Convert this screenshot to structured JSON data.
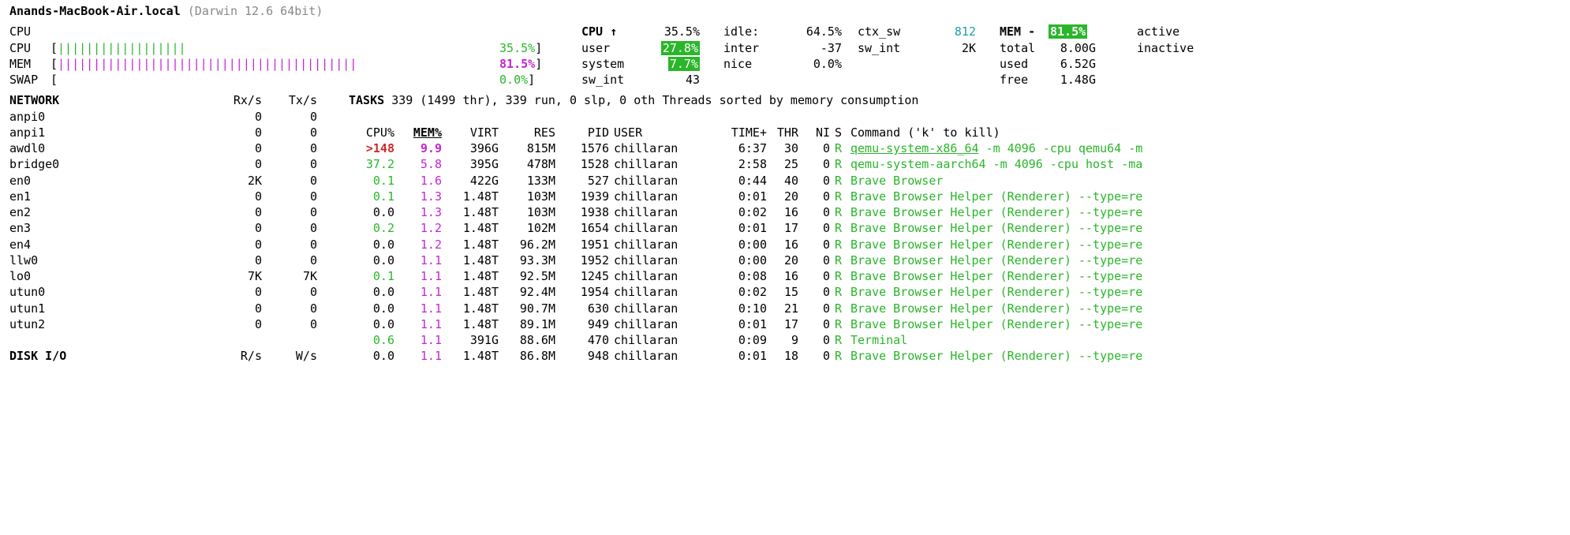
{
  "host": {
    "name": "Anands-MacBook-Air.local",
    "os": "(Darwin 12.6 64bit)"
  },
  "meters": {
    "cpu_label": "CPU",
    "cpu_bar": "||||||||||||||||||",
    "cpu_pct": "35.5%",
    "mem_label": "MEM",
    "mem_bar": "||||||||||||||||||||||||||||||||||||||||||",
    "mem_pct": "81.5%",
    "swap_label": "SWAP",
    "swap_bar": "",
    "swap_pct": "0.0%"
  },
  "cpu_stats": {
    "title": "CPU ↑",
    "title_val": "35.5%",
    "user_l": "user",
    "user_v": "27.8%",
    "system_l": "system",
    "system_v": "7.7%",
    "swint_topl": "sw_int",
    "swint_topv": "43",
    "idle_l": "idle:",
    "idle_v": "64.5%",
    "inter_l": "inter",
    "inter_v": "-37",
    "nice_l": "nice",
    "nice_v": "0.0%",
    "ctx_l": "ctx_sw",
    "ctx_v": "812",
    "swint_l": "sw_int",
    "swint_v": "2K"
  },
  "mem_stats": {
    "title": "MEM -",
    "title_v": "81.5%",
    "total_l": "total",
    "total_v": "8.00G",
    "used_l": "used",
    "used_v": "6.52G",
    "free_l": "free",
    "free_v": "1.48G",
    "active_l": "active",
    "inactive_l": "inactive"
  },
  "tasks_line": {
    "l": "TASKS",
    "r": "339 (1499 thr), 339 run, 0 slp, 0 oth Threads sorted by memory consumption"
  },
  "net_hdr": {
    "l": "NETWORK",
    "rx": "Rx/s",
    "tx": "Tx/s"
  },
  "disk_hdr": {
    "l": "DISK I/O",
    "r": "R/s",
    "w": "W/s"
  },
  "net_ifs": [
    {
      "n": "anpi0",
      "rx": "0",
      "tx": "0"
    },
    {
      "n": "anpi1",
      "rx": "0",
      "tx": "0"
    },
    {
      "n": "awdl0",
      "rx": "0",
      "tx": "0"
    },
    {
      "n": "bridge0",
      "rx": "0",
      "tx": "0"
    },
    {
      "n": "en0",
      "rx": "2K",
      "tx": "0"
    },
    {
      "n": "en1",
      "rx": "0",
      "tx": "0"
    },
    {
      "n": "en2",
      "rx": "0",
      "tx": "0"
    },
    {
      "n": "en3",
      "rx": "0",
      "tx": "0"
    },
    {
      "n": "en4",
      "rx": "0",
      "tx": "0"
    },
    {
      "n": "llw0",
      "rx": "0",
      "tx": "0"
    },
    {
      "n": "lo0",
      "rx": "7K",
      "tx": "7K"
    },
    {
      "n": "utun0",
      "rx": "0",
      "tx": "0"
    },
    {
      "n": "utun1",
      "rx": "0",
      "tx": "0"
    },
    {
      "n": "utun2",
      "rx": "0",
      "tx": "0"
    }
  ],
  "proc_hdr": {
    "cpu": "CPU%",
    "mem": "MEM%",
    "virt": "VIRT",
    "res": "RES",
    "pid": "PID",
    "user": "USER",
    "time": "TIME+",
    "thr": "THR",
    "ni": "NI",
    "s": "S",
    "cmd": "Command ('k' to kill)"
  },
  "procs": [
    {
      "cpu": ">148",
      "cpu_class": "red bold",
      "mem": "9.9",
      "mem_b": true,
      "virt": "396G",
      "res": "815M",
      "pid": "1576",
      "user": "chillaran",
      "time": "6:37",
      "thr": "30",
      "ni": "0",
      "s": "R",
      "cmd1": "qemu-system-x86_64",
      "cmd2": " -m 4096 -cpu qemu64 -m"
    },
    {
      "cpu": "37.2",
      "cpu_class": "green",
      "mem": "5.8",
      "virt": "395G",
      "res": "478M",
      "pid": "1528",
      "user": "chillaran",
      "time": "2:58",
      "thr": "25",
      "ni": "0",
      "s": "R",
      "cmd1": "qemu-system-aarch64",
      "cmd2": " -m 4096 -cpu host -ma"
    },
    {
      "cpu": "0.1",
      "cpu_class": "green",
      "mem": "1.6",
      "virt": "422G",
      "res": "133M",
      "pid": "527",
      "user": "chillaran",
      "time": "0:44",
      "thr": "40",
      "ni": "0",
      "s": "R",
      "cmd1": "Brave Browser",
      "cmd2": ""
    },
    {
      "cpu": "0.1",
      "cpu_class": "green",
      "mem": "1.3",
      "virt": "1.48T",
      "res": "103M",
      "pid": "1939",
      "user": "chillaran",
      "time": "0:01",
      "thr": "20",
      "ni": "0",
      "s": "R",
      "cmd1": "Brave Browser Helper (Renderer)",
      "cmd2": " --type=re"
    },
    {
      "cpu": "0.0",
      "cpu_class": "",
      "mem": "1.3",
      "virt": "1.48T",
      "res": "103M",
      "pid": "1938",
      "user": "chillaran",
      "time": "0:02",
      "thr": "16",
      "ni": "0",
      "s": "R",
      "cmd1": "Brave Browser Helper (Renderer)",
      "cmd2": " --type=re"
    },
    {
      "cpu": "0.2",
      "cpu_class": "green",
      "mem": "1.2",
      "virt": "1.48T",
      "res": "102M",
      "pid": "1654",
      "user": "chillaran",
      "time": "0:01",
      "thr": "17",
      "ni": "0",
      "s": "R",
      "cmd1": "Brave Browser Helper (Renderer)",
      "cmd2": " --type=re"
    },
    {
      "cpu": "0.0",
      "cpu_class": "",
      "mem": "1.2",
      "virt": "1.48T",
      "res": "96.2M",
      "pid": "1951",
      "user": "chillaran",
      "time": "0:00",
      "thr": "16",
      "ni": "0",
      "s": "R",
      "cmd1": "Brave Browser Helper (Renderer)",
      "cmd2": " --type=re"
    },
    {
      "cpu": "0.0",
      "cpu_class": "",
      "mem": "1.1",
      "virt": "1.48T",
      "res": "93.3M",
      "pid": "1952",
      "user": "chillaran",
      "time": "0:00",
      "thr": "20",
      "ni": "0",
      "s": "R",
      "cmd1": "Brave Browser Helper (Renderer)",
      "cmd2": " --type=re"
    },
    {
      "cpu": "0.1",
      "cpu_class": "green",
      "mem": "1.1",
      "virt": "1.48T",
      "res": "92.5M",
      "pid": "1245",
      "user": "chillaran",
      "time": "0:08",
      "thr": "16",
      "ni": "0",
      "s": "R",
      "cmd1": "Brave Browser Helper (Renderer)",
      "cmd2": " --type=re"
    },
    {
      "cpu": "0.0",
      "cpu_class": "",
      "mem": "1.1",
      "virt": "1.48T",
      "res": "92.4M",
      "pid": "1954",
      "user": "chillaran",
      "time": "0:02",
      "thr": "15",
      "ni": "0",
      "s": "R",
      "cmd1": "Brave Browser Helper (Renderer)",
      "cmd2": " --type=re"
    },
    {
      "cpu": "0.0",
      "cpu_class": "",
      "mem": "1.1",
      "virt": "1.48T",
      "res": "90.7M",
      "pid": "630",
      "user": "chillaran",
      "time": "0:10",
      "thr": "21",
      "ni": "0",
      "s": "R",
      "cmd1": "Brave Browser Helper (Renderer)",
      "cmd2": " --type=re"
    },
    {
      "cpu": "0.0",
      "cpu_class": "",
      "mem": "1.1",
      "virt": "1.48T",
      "res": "89.1M",
      "pid": "949",
      "user": "chillaran",
      "time": "0:01",
      "thr": "17",
      "ni": "0",
      "s": "R",
      "cmd1": "Brave Browser Helper (Renderer)",
      "cmd2": " --type=re"
    },
    {
      "cpu": "0.6",
      "cpu_class": "green",
      "mem": "1.1",
      "virt": "391G",
      "res": "88.6M",
      "pid": "470",
      "user": "chillaran",
      "time": "0:09",
      "thr": "9",
      "ni": "0",
      "s": "R",
      "cmd1": "Terminal",
      "cmd2": ""
    },
    {
      "cpu": "0.0",
      "cpu_class": "",
      "mem": "1.1",
      "virt": "1.48T",
      "res": "86.8M",
      "pid": "948",
      "user": "chillaran",
      "time": "0:01",
      "thr": "18",
      "ni": "0",
      "s": "R",
      "cmd1": "Brave Browser Helper (Renderer)",
      "cmd2": " --type=re"
    }
  ]
}
